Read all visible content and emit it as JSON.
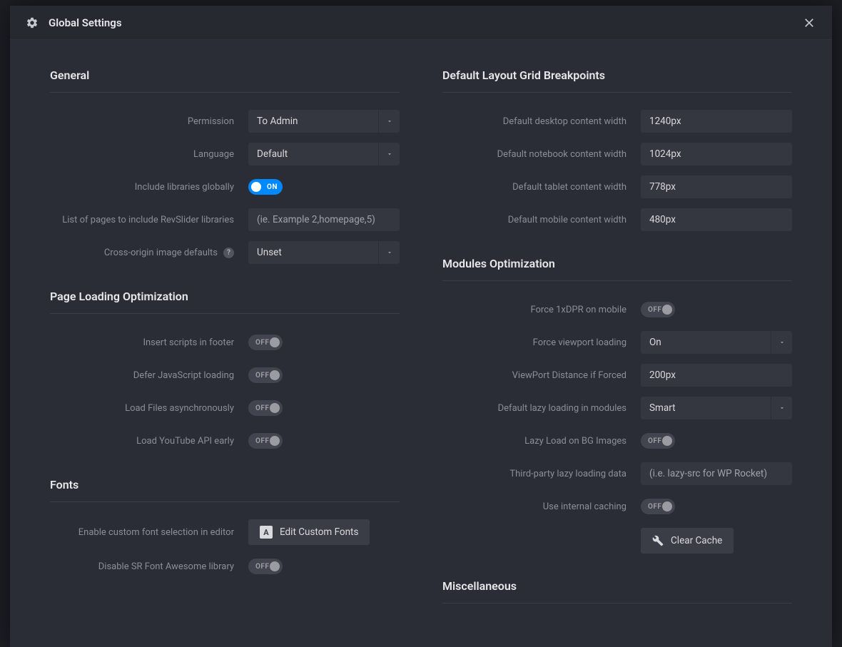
{
  "header": {
    "title": "Global Settings"
  },
  "labels": {
    "on": "ON",
    "off": "OFF"
  },
  "left": {
    "general": {
      "title": "General",
      "permission": {
        "label": "Permission",
        "value": "To Admin"
      },
      "language": {
        "label": "Language",
        "value": "Default"
      },
      "include_globally": {
        "label": "Include libraries globally",
        "state": "ON"
      },
      "page_list": {
        "label": "List of pages to include RevSlider libraries",
        "placeholder": "(ie. Example 2,homepage,5)"
      },
      "cross_origin": {
        "label": "Cross-origin image defaults",
        "value": "Unset"
      }
    },
    "page_loading": {
      "title": "Page Loading Optimization",
      "insert_footer": {
        "label": "Insert scripts in footer",
        "state": "OFF"
      },
      "defer_js": {
        "label": "Defer JavaScript loading",
        "state": "OFF"
      },
      "async_files": {
        "label": "Load Files asynchronously",
        "state": "OFF"
      },
      "youtube_early": {
        "label": "Load YouTube API early",
        "state": "OFF"
      }
    },
    "fonts": {
      "title": "Fonts",
      "enable_custom": {
        "label": "Enable custom font selection in editor",
        "button": "Edit Custom Fonts"
      },
      "disable_fa": {
        "label": "Disable SR Font Awesome library",
        "state": "OFF"
      }
    }
  },
  "right": {
    "breakpoints": {
      "title": "Default Layout Grid Breakpoints",
      "desktop": {
        "label": "Default desktop content width",
        "value": "1240px"
      },
      "notebook": {
        "label": "Default notebook content width",
        "value": "1024px"
      },
      "tablet": {
        "label": "Default tablet content width",
        "value": "778px"
      },
      "mobile": {
        "label": "Default mobile content width",
        "value": "480px"
      }
    },
    "modules": {
      "title": "Modules Optimization",
      "force_1xdpr": {
        "label": "Force 1xDPR on mobile",
        "state": "OFF"
      },
      "force_viewport": {
        "label": "Force viewport loading",
        "value": "On"
      },
      "viewport_distance": {
        "label": "ViewPort Distance if Forced",
        "value": "200px"
      },
      "lazy_loading": {
        "label": "Default lazy loading in modules",
        "value": "Smart"
      },
      "lazy_bg": {
        "label": "Lazy Load on BG Images",
        "state": "OFF"
      },
      "third_party": {
        "label": "Third-party lazy loading data",
        "placeholder": "(i.e. lazy-src for WP Rocket)"
      },
      "internal_cache": {
        "label": "Use internal caching",
        "state": "OFF"
      },
      "clear_cache": "Clear Cache"
    },
    "misc": {
      "title": "Miscellaneous"
    }
  }
}
